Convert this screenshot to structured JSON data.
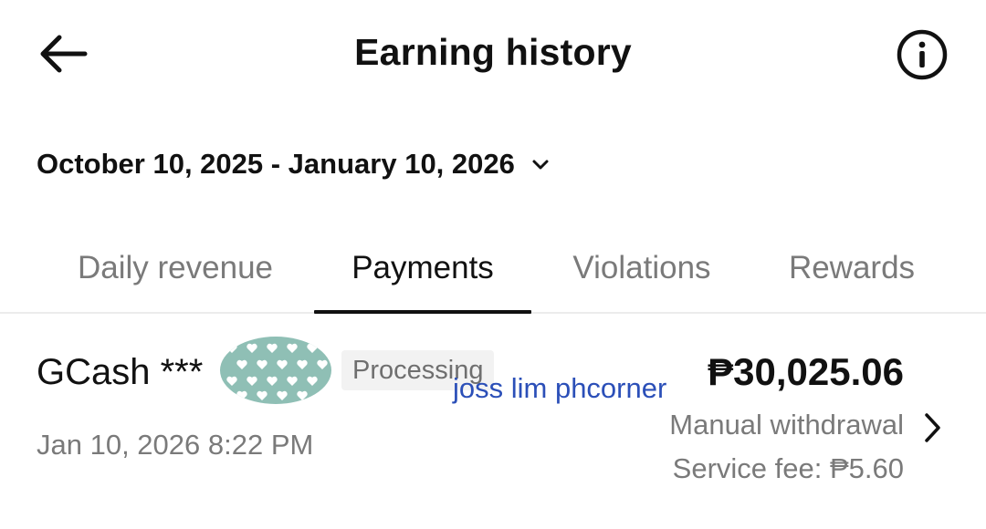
{
  "header": {
    "title": "Earning history",
    "back_icon": "arrow-left-icon",
    "info_icon": "info-circle-icon"
  },
  "date_range": {
    "label": "October 10, 2025 - January 10, 2026",
    "icon": "chevron-down-icon"
  },
  "tabs": [
    {
      "label": "Daily revenue",
      "active": false
    },
    {
      "label": "Payments",
      "active": true
    },
    {
      "label": "Violations",
      "active": false
    },
    {
      "label": "Rewards",
      "active": false
    }
  ],
  "payments": [
    {
      "method": "GCash ***",
      "status": "Processing",
      "amount": "₱30,025.06",
      "date": "Jan 10, 2026 8:22 PM",
      "type": "Manual withdrawal",
      "service_fee": "Service fee: ₱5.60",
      "watermark": "joss lim phcorner"
    }
  ],
  "colors": {
    "text_primary": "#111111",
    "text_secondary": "#7a7a7a",
    "badge_bg": "#f2f2f2",
    "mask_fill": "#8fbfb5",
    "watermark": "#2b4fb8"
  }
}
